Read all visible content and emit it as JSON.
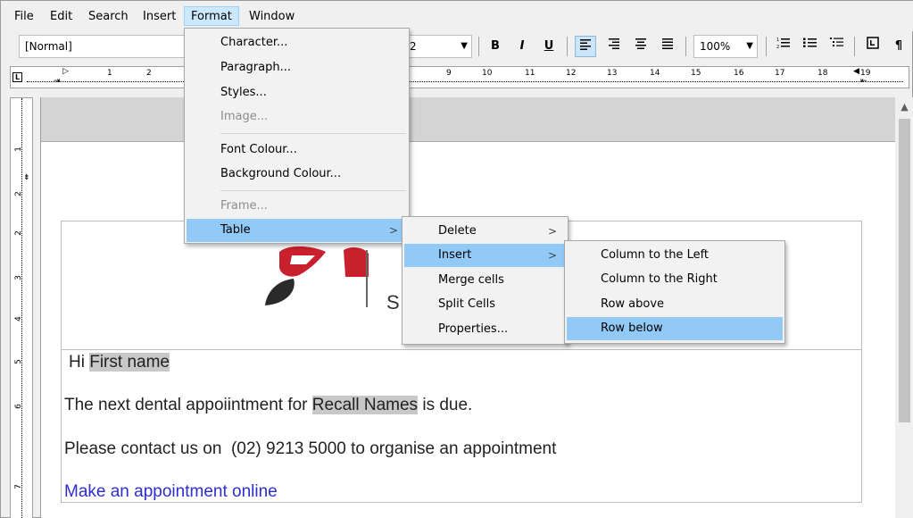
{
  "menubar": {
    "items": [
      "File",
      "Edit",
      "Search",
      "Insert",
      "Format",
      "Window"
    ]
  },
  "toolbar": {
    "style_value": "[Normal]",
    "font_size_value": "2",
    "bold": "B",
    "italic": "I",
    "underline": "U",
    "zoom_value": "100%",
    "icons": [
      "font-size-dropdown-arrow",
      "bold-icon",
      "italic-icon",
      "underline-icon",
      "align-left-icon",
      "align-right-icon",
      "align-center-icon",
      "justify-icon",
      "zoom-dropdown-arrow",
      "numbered-list-icon",
      "bullet-list-icon",
      "outline-list-icon",
      "page-frame-icon",
      "pilcrow-icon"
    ]
  },
  "ruler": {
    "numbers": [
      "1",
      "2",
      "9",
      "10",
      "11",
      "12",
      "13",
      "14",
      "15",
      "16",
      "17",
      "18",
      "19"
    ]
  },
  "vruler": {
    "numbers": [
      "1",
      "2",
      "3",
      "4",
      "5",
      "6",
      "7"
    ]
  },
  "format_menu": {
    "items": [
      {
        "label": "Character...",
        "enabled": true
      },
      {
        "label": "Paragraph...",
        "enabled": true
      },
      {
        "label": "Styles...",
        "enabled": true
      },
      {
        "label": "Image...",
        "enabled": false
      },
      {
        "label": "Font Colour...",
        "enabled": true
      },
      {
        "label": "Background Colour...",
        "enabled": true
      },
      {
        "label": "Frame...",
        "enabled": false
      },
      {
        "label": "Table",
        "enabled": true,
        "submenu": true,
        "highlighted": true
      }
    ]
  },
  "table_menu": {
    "items": [
      {
        "label": "Delete",
        "submenu": true
      },
      {
        "label": "Insert",
        "submenu": true,
        "highlighted": true
      },
      {
        "label": "Merge cells"
      },
      {
        "label": "Split Cells"
      },
      {
        "label": "Properties..."
      }
    ]
  },
  "insert_menu": {
    "items": [
      {
        "label": "Column to the Left"
      },
      {
        "label": "Column to the Right"
      },
      {
        "label": "Row above"
      },
      {
        "label": "Row below",
        "highlighted": true
      }
    ]
  },
  "document": {
    "greeting_prefix": "Hi",
    "greeting_field": "First name",
    "line2_prefix": "The next dental appoiintment for",
    "line2_field": "Recall Names",
    "line2_suffix": "is due.",
    "line3": "Please contact us on  (02) 9213 5000 to organise an appointment",
    "link": "Make an appointment online",
    "logo_text_partial": "S"
  },
  "colors": {
    "menu_highlight": "#91c9f7",
    "link": "#2d2dd0",
    "field_bg": "#c8c8c8",
    "logo_red": "#c8202c",
    "logo_dark": "#2a2a2a"
  }
}
